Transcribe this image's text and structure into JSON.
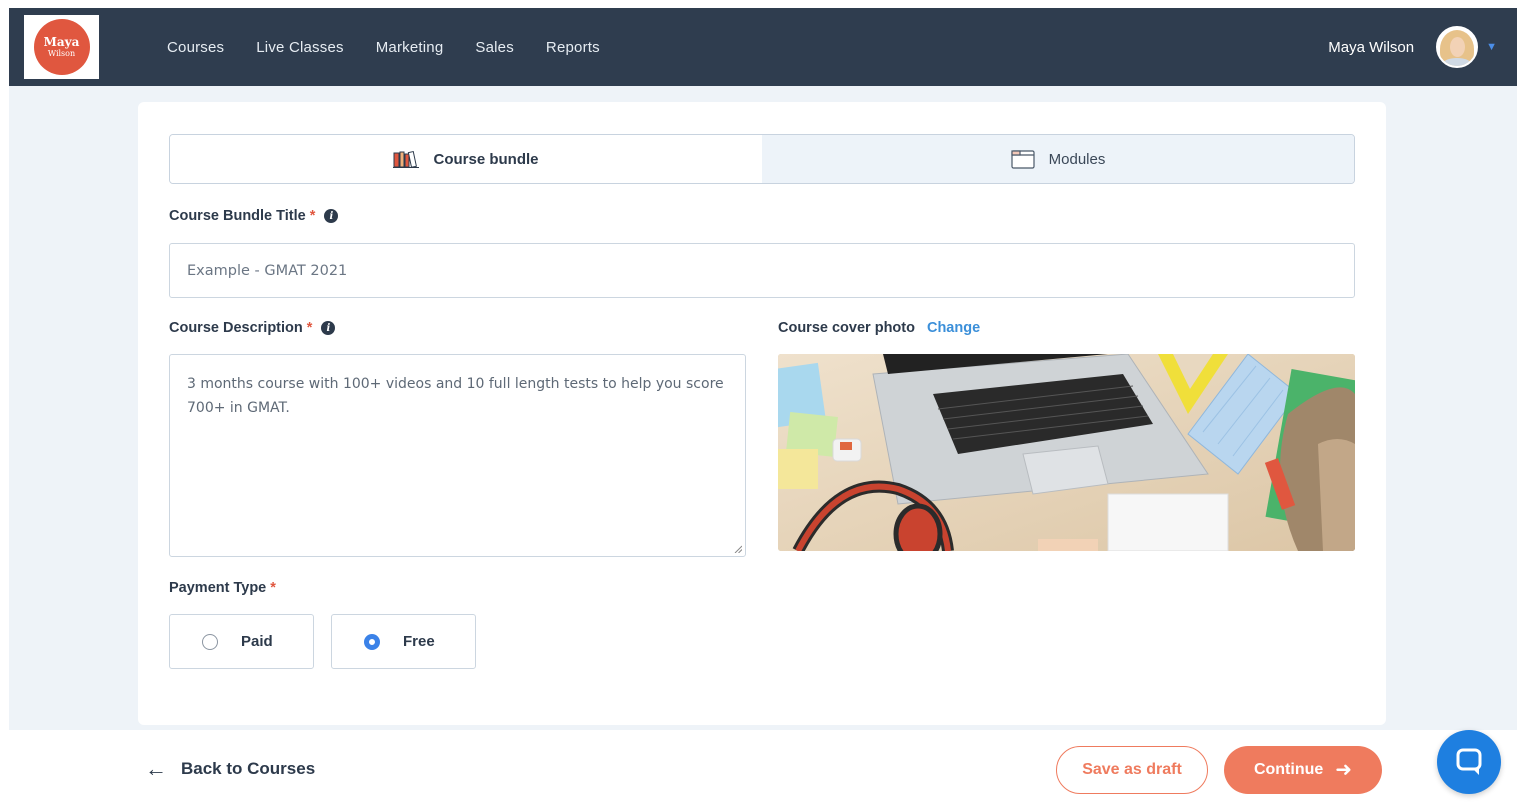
{
  "nav": {
    "logo_line1": "Maya",
    "logo_line2": "Wilson",
    "links": [
      "Courses",
      "Live Classes",
      "Marketing",
      "Sales",
      "Reports"
    ],
    "user_name": "Maya Wilson"
  },
  "tabs": [
    {
      "label": "Course bundle",
      "icon": "books-icon",
      "active": true
    },
    {
      "label": "Modules",
      "icon": "folder-icon",
      "active": false
    }
  ],
  "form": {
    "title_label": "Course Bundle Title",
    "title_placeholder": "Example - GMAT 2021",
    "description_label": "Course Description",
    "description_value": "3 months course with 100+ videos and 10 full length tests to help you score 700+ in GMAT.",
    "cover_label": "Course cover photo",
    "cover_change": "Change",
    "payment_label": "Payment Type",
    "required_mark": "*",
    "payment_options": [
      {
        "label": "Paid",
        "selected": false
      },
      {
        "label": "Free",
        "selected": true
      }
    ]
  },
  "footer": {
    "back_label": "Back to Courses",
    "save_draft_label": "Save as draft",
    "continue_label": "Continue"
  },
  "colors": {
    "nav_bg": "#2f3d4f",
    "accent": "#ef7b5e",
    "link": "#3b8fd9",
    "radio_selected": "#3b82e8",
    "chat": "#1e7fe0"
  }
}
